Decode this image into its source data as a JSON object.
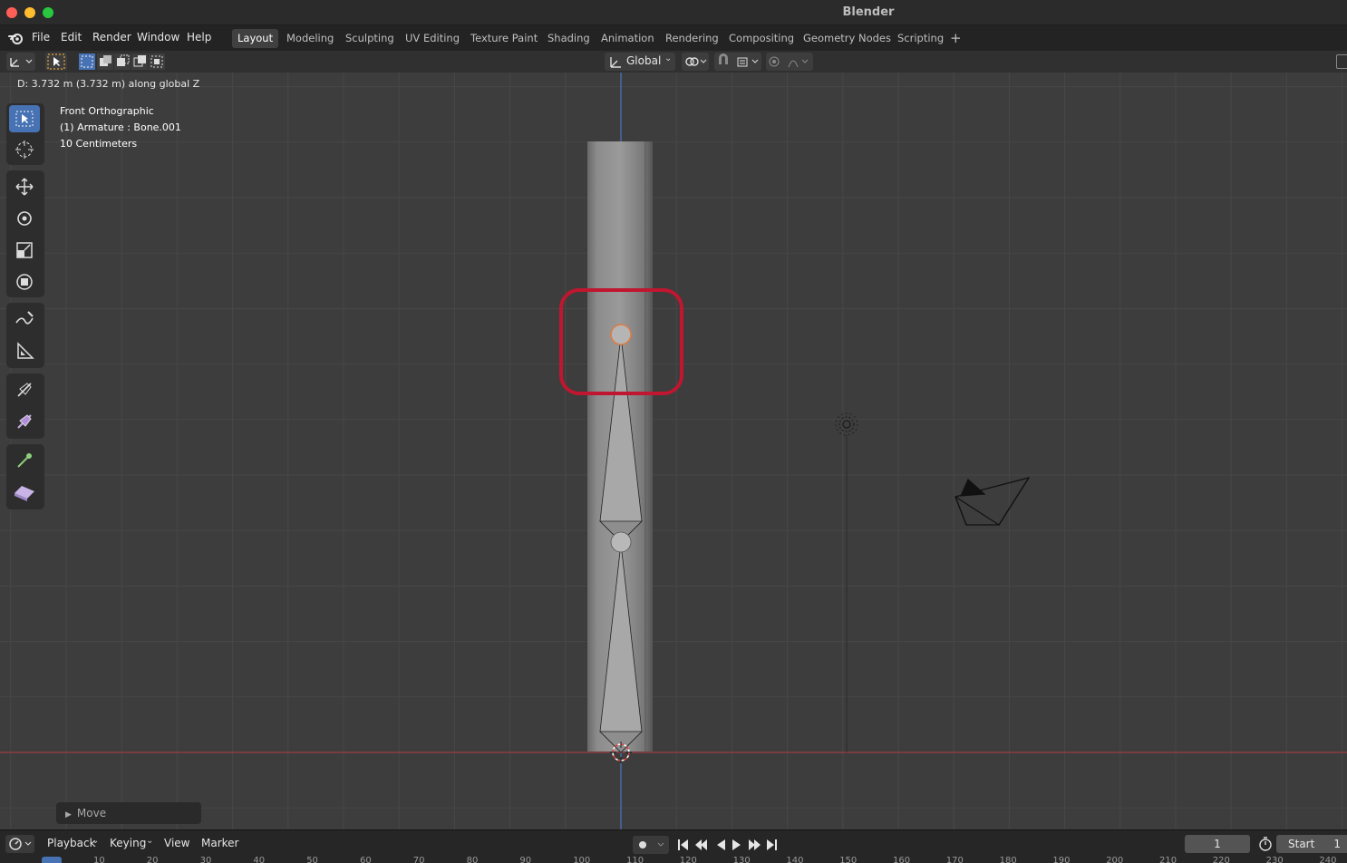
{
  "window": {
    "title": "Blender"
  },
  "menus": [
    "File",
    "Edit",
    "Render",
    "Window",
    "Help"
  ],
  "workspaces": [
    {
      "label": "Layout",
      "active": true
    },
    {
      "label": "Modeling"
    },
    {
      "label": "Sculpting"
    },
    {
      "label": "UV Editing"
    },
    {
      "label": "Texture Paint"
    },
    {
      "label": "Shading"
    },
    {
      "label": "Animation"
    },
    {
      "label": "Rendering"
    },
    {
      "label": "Compositing"
    },
    {
      "label": "Geometry Nodes"
    },
    {
      "label": "Scripting"
    }
  ],
  "header": {
    "transform_orientation": "Global"
  },
  "viewport": {
    "status": "D: 3.732 m (3.732 m) along global Z",
    "view_name": "Front Orthographic",
    "object_info": "(1) Armature : Bone.001",
    "grid_scale": "10 Centimeters"
  },
  "last_operation": {
    "label": "Move"
  },
  "timeline": {
    "menus": [
      "Playback",
      "Keying",
      "View",
      "Marker"
    ],
    "current_frame": "1",
    "start_label": "Start",
    "start_value": "1",
    "ruler": [
      "10",
      "20",
      "30",
      "40",
      "50",
      "60",
      "70",
      "80",
      "90",
      "100",
      "110",
      "120",
      "130",
      "140",
      "150",
      "160",
      "170",
      "180",
      "190",
      "200",
      "210",
      "220",
      "230",
      "240"
    ]
  },
  "colors": {
    "accent": "#4772b3",
    "highlight": "#c0162f",
    "x_axis": "#b53a44",
    "z_axis": "#4d7fd6"
  }
}
